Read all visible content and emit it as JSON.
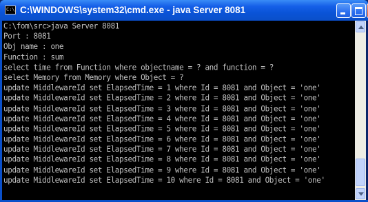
{
  "window": {
    "title": "C:\\WINDOWS\\system32\\cmd.exe - java Server 8081",
    "icon": "command-prompt-icon",
    "icon_glyph": "C:\\"
  },
  "title_buttons": {
    "minimize_icon": "minimize-icon",
    "maximize_icon": "maximize-icon",
    "close_icon": "close-icon",
    "close_glyph": "×"
  },
  "console": {
    "lines": [
      "C:\\fom\\src>java Server 8081",
      "Port : 8081",
      "Obj name : one",
      "Function : sum",
      "select time from Function where objectname = ? and function = ?",
      "select Memory from Memory where Object = ?",
      "update MiddlewareId set ElapsedTime = 1 where Id = 8081 and Object = 'one'",
      "update MiddlewareId set ElapsedTime = 2 where Id = 8081 and Object = 'one'",
      "update MiddlewareId set ElapsedTime = 3 where Id = 8081 and Object = 'one'",
      "update MiddlewareId set ElapsedTime = 4 where Id = 8081 and Object = 'one'",
      "update MiddlewareId set ElapsedTime = 5 where Id = 8081 and Object = 'one'",
      "update MiddlewareId set ElapsedTime = 6 where Id = 8081 and Object = 'one'",
      "update MiddlewareId set ElapsedTime = 7 where Id = 8081 and Object = 'one'",
      "update MiddlewareId set ElapsedTime = 8 where Id = 8081 and Object = 'one'",
      "update MiddlewareId set ElapsedTime = 9 where Id = 8081 and Object = 'one'",
      "update MiddlewareId set ElapsedTime = 10 where Id = 8081 and Object = 'one'"
    ],
    "text_color": "#c0c0c0",
    "background_color": "#000000"
  },
  "colors": {
    "titlebar": "#0a54d8",
    "title_text": "#ffffff",
    "close_button": "#d9502a"
  }
}
